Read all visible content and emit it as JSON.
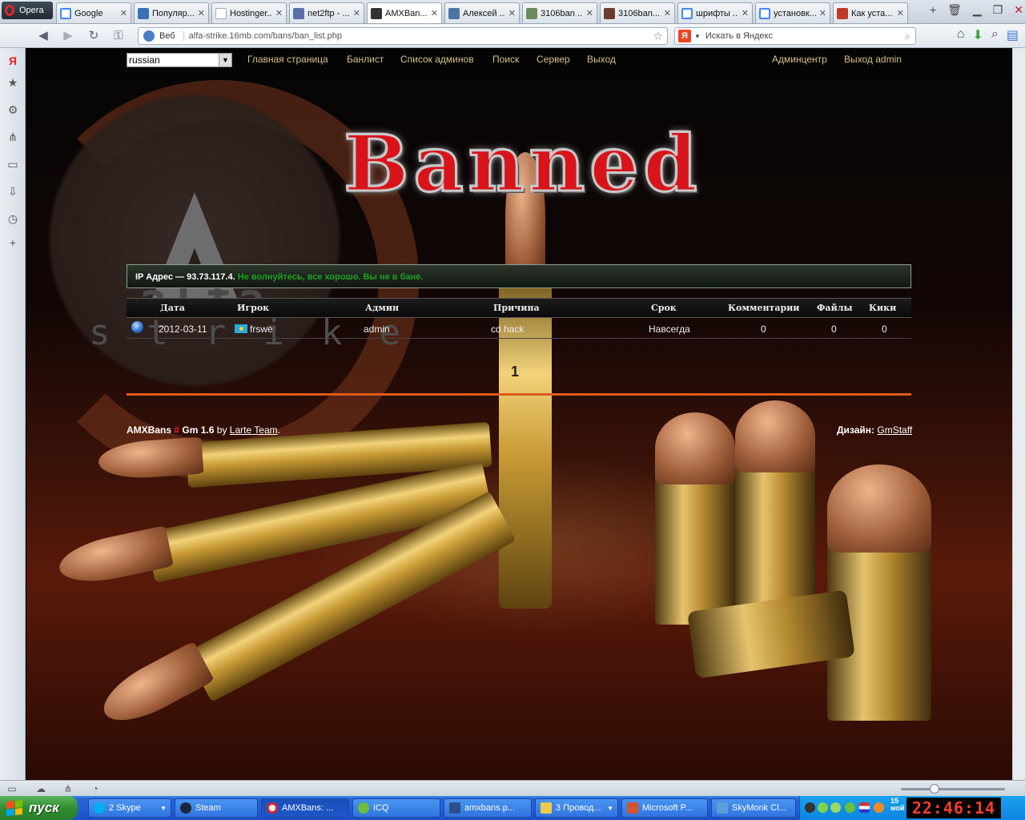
{
  "browser": {
    "opera_label": "Opera",
    "tabs": [
      {
        "label": "Google",
        "icon": "google-icon",
        "color": "#4285f4"
      },
      {
        "label": "Популяр...",
        "icon": "play-icon",
        "color": "#3b6fb6"
      },
      {
        "label": "Hostinger...",
        "icon": "blank-page-icon",
        "color": "#ffffff"
      },
      {
        "label": "net2ftp - ...",
        "icon": "net2ftp-icon",
        "color": "#5a6fa5"
      },
      {
        "label": "AMXBan...",
        "icon": "amxbans-icon",
        "color": "#333333"
      },
      {
        "label": "Алексей ...",
        "icon": "vk-icon",
        "color": "#4c75a3"
      },
      {
        "label": "3106ban ...",
        "icon": "image-icon",
        "color": "#6a8a5a"
      },
      {
        "label": "3106ban....",
        "icon": "image-icon",
        "color": "#6b3d2a"
      },
      {
        "label": "шрифты ...",
        "icon": "google-icon",
        "color": "#4285f4"
      },
      {
        "label": "установк...",
        "icon": "google-icon",
        "color": "#4285f4"
      },
      {
        "label": "Как уста...",
        "icon": "p-icon",
        "color": "#c0392b"
      }
    ],
    "address": {
      "web_label": "Веб",
      "url": "alfa-strike.16mb.com/bans/ban_list.php"
    },
    "search": {
      "engine_letter": "Я",
      "placeholder": "Искать в Яндекс"
    }
  },
  "page": {
    "language": "russian",
    "nav": [
      "Главная страница",
      "Банлист",
      "Список админов",
      "Поиск",
      "Сервер",
      "Выход"
    ],
    "nav_right": [
      "Админцентр",
      "Выход admin"
    ],
    "title": "Banned",
    "logo_text": {
      "letter": "A",
      "word": "alfa",
      "strike": "strike"
    },
    "ip": {
      "label": "IP Адрес — 93.73.117.4.",
      "message": "Не волнуйтесь, все хорошо. Вы не в бане."
    },
    "bans_table": {
      "headers": [
        "Дата",
        "Игрок",
        "Админ",
        "Причина",
        "Срок",
        "Комментарии",
        "Файлы",
        "Кики"
      ],
      "rows": [
        {
          "date": "2012-03-11",
          "player": "frswe",
          "admin": "admin",
          "reason": "cd hack",
          "term": "Навсегда",
          "comments": "0",
          "files": "0",
          "kicks": "0"
        }
      ]
    },
    "pager": "1",
    "footer": {
      "product": "AMXBans",
      "hash": "#",
      "version": "Gm 1.6",
      "by": "by",
      "team": "Larte Team",
      "team_suffix": ".",
      "design_label": "Дизайн:",
      "design_link": "GmStaff"
    }
  },
  "taskbar": {
    "start_label": "пуск",
    "tasks": [
      {
        "label": "2 Skype",
        "color": "#00aff0"
      },
      {
        "label": "Steam",
        "color": "#1b2838"
      },
      {
        "label": "AMXBans: ...",
        "color": "#e0262d"
      },
      {
        "label": "ICQ",
        "color": "#6bbf3a"
      },
      {
        "label": "amxbans.p...",
        "color": "#2c4f8c"
      },
      {
        "label": "3 Провод...",
        "color": "#f2c94c"
      },
      {
        "label": "Microsoft P...",
        "color": "#d35230"
      },
      {
        "label": "SkyMonk Cl...",
        "color": "#5aa0d8"
      }
    ],
    "clock": "22:46:14",
    "date_top": "15",
    "date_bottom": "мой"
  }
}
